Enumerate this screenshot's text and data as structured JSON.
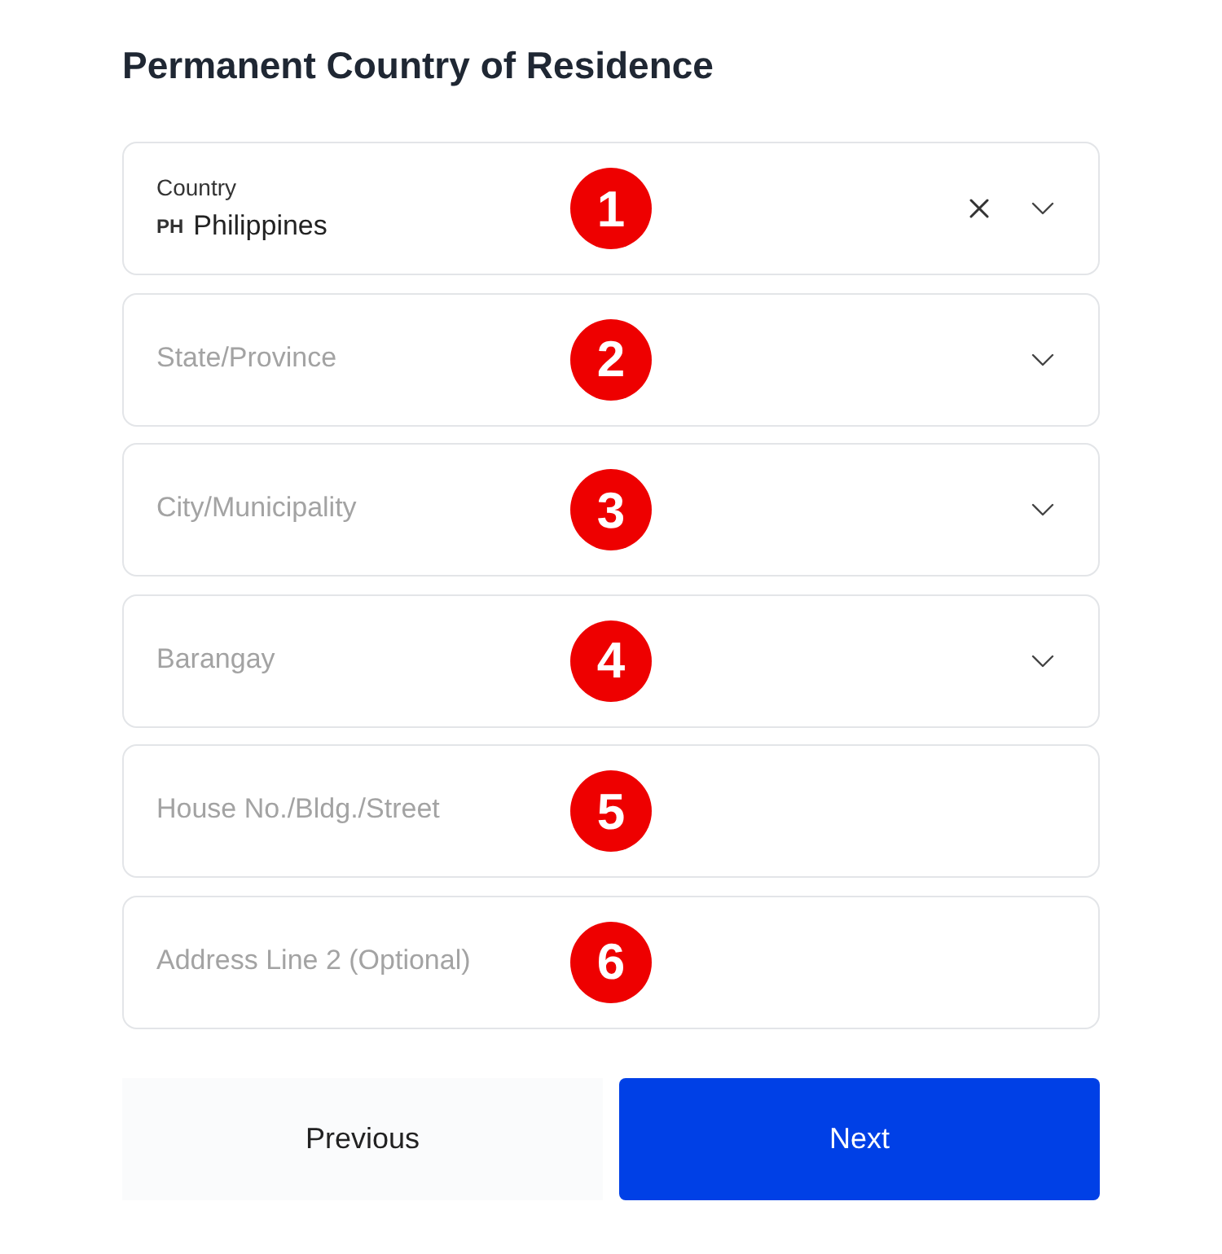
{
  "title": "Permanent Country of Residence",
  "fields": [
    {
      "kind": "select",
      "label": "Country",
      "code": "PH",
      "value": "Philippines",
      "clearable": true,
      "marker": "1"
    },
    {
      "kind": "select",
      "placeholder": "State/Province",
      "clearable": false,
      "marker": "2"
    },
    {
      "kind": "select",
      "placeholder": "City/Municipality",
      "clearable": false,
      "marker": "3"
    },
    {
      "kind": "select",
      "placeholder": "Barangay",
      "clearable": false,
      "marker": "4"
    },
    {
      "kind": "text",
      "placeholder": "House No./Bldg./Street",
      "marker": "5"
    },
    {
      "kind": "text",
      "placeholder": "Address Line 2 (Optional)",
      "marker": "6"
    }
  ],
  "buttons": [
    {
      "kind": "secondary",
      "label": "Previous"
    },
    {
      "kind": "primary",
      "label": "Next"
    }
  ]
}
